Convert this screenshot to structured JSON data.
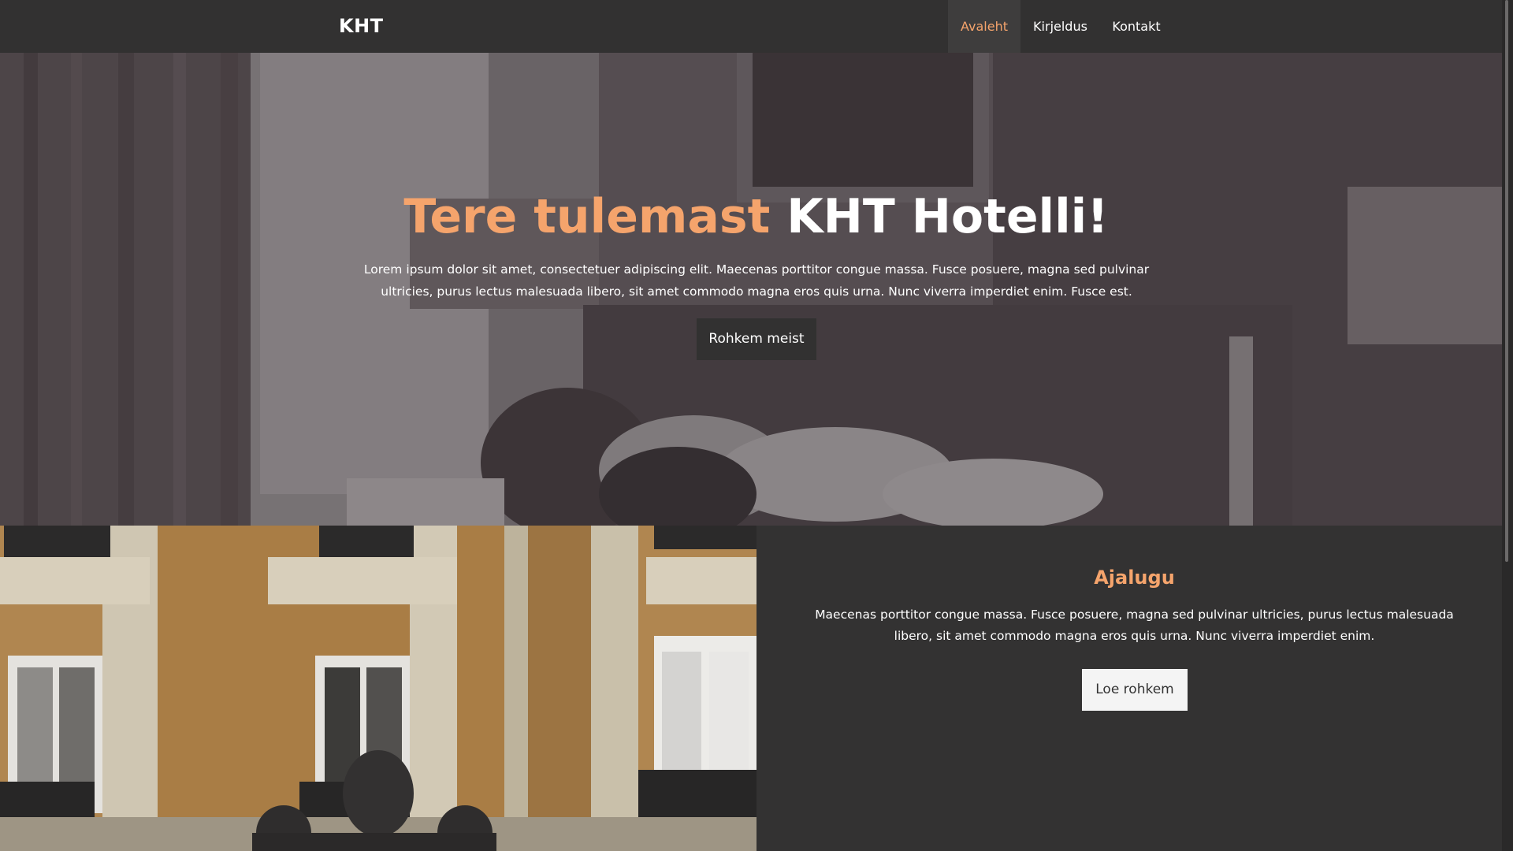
{
  "nav": {
    "brand": "KHT",
    "items": [
      {
        "label": "Avaleht",
        "active": true
      },
      {
        "label": "Kirjeldus",
        "active": false
      },
      {
        "label": "Kontakt",
        "active": false
      }
    ]
  },
  "hero": {
    "title_accent": "Tere tulemast",
    "title_rest": "KHT Hotelli!",
    "text": "Lorem ipsum dolor sit amet, consectetuer adipiscing elit. Maecenas porttitor congue massa. Fusce posuere, magna sed pulvinar ultricies, purus lectus malesuada libero, sit amet commodo magna eros quis urna. Nunc viverra imperdiet enim. Fusce est.",
    "button": "Rohkem meist"
  },
  "history": {
    "title": "Ajalugu",
    "text": "Maecenas porttitor congue massa. Fusce posuere, magna sed pulvinar ultricies, purus lectus malesuada libero, sit amet commodo magna eros quis urna. Nunc viverra imperdiet enim.",
    "button": "Loe rohkem"
  },
  "colors": {
    "accent": "#f5a46c",
    "dark": "#323131",
    "background": "#333232"
  }
}
